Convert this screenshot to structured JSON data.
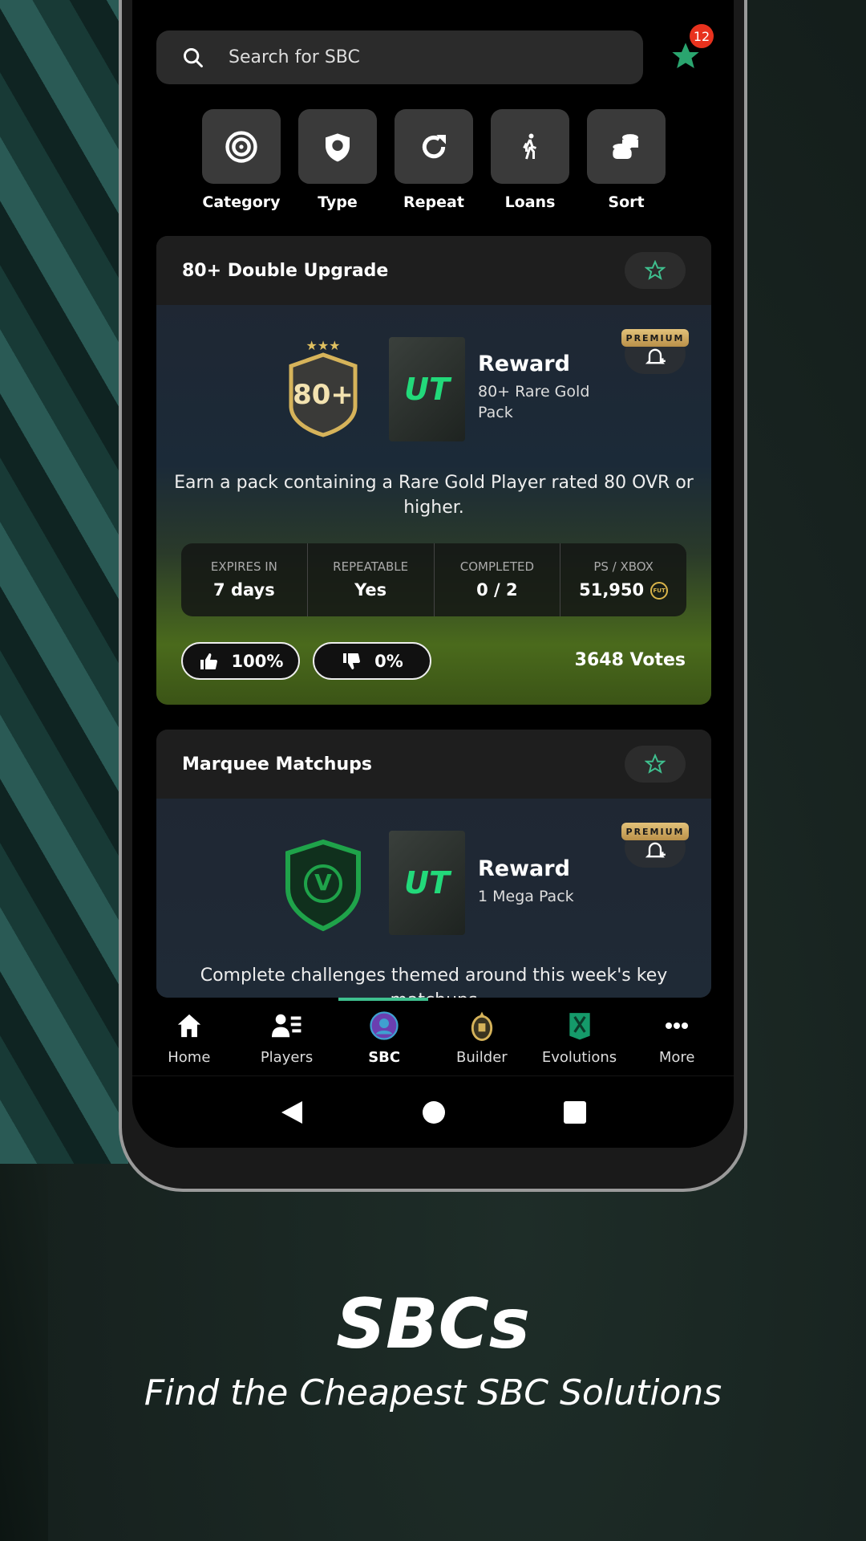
{
  "search": {
    "placeholder": "Search for SBC"
  },
  "favorites": {
    "count": "12"
  },
  "filters": [
    {
      "label": "Category",
      "icon": "target-icon"
    },
    {
      "label": "Type",
      "icon": "shield-ball-icon"
    },
    {
      "label": "Repeat",
      "icon": "repeat-icon"
    },
    {
      "label": "Loans",
      "icon": "walking-icon"
    },
    {
      "label": "Sort",
      "icon": "coins-icon"
    }
  ],
  "cards": [
    {
      "title": "80+ Double Upgrade",
      "premium": "PREMIUM",
      "reward_title": "Reward",
      "reward": "80+ Rare Gold Pack",
      "badge_text": "80+",
      "pack_text": "UT",
      "description": "Earn a pack containing a Rare Gold Player rated 80 OVR or higher.",
      "stats": [
        {
          "label": "EXPIRES IN",
          "value": "7 days"
        },
        {
          "label": "REPEATABLE",
          "value": "Yes"
        },
        {
          "label": "COMPLETED",
          "value": "0 / 2"
        },
        {
          "label": "PS / XBOX",
          "value": "51,950"
        }
      ],
      "coin_label": "FUT",
      "upvote": "100%",
      "downvote": "0%",
      "votes": "3648 Votes"
    },
    {
      "title": "Marquee Matchups",
      "premium": "PREMIUM",
      "reward_title": "Reward",
      "reward": "1 Mega Pack",
      "badge_text": "V",
      "pack_text": "UT",
      "description": "Complete challenges themed around this week's key matchups"
    }
  ],
  "nav": [
    {
      "label": "Home"
    },
    {
      "label": "Players"
    },
    {
      "label": "SBC",
      "active": true
    },
    {
      "label": "Builder"
    },
    {
      "label": "Evolutions"
    },
    {
      "label": "More"
    }
  ],
  "colors": {
    "accent": "#3fc08f",
    "badge": "#e8321e",
    "premium": "#d9b46a"
  },
  "promo": {
    "title": "SBCs",
    "subtitle": "Find the Cheapest SBC Solutions"
  }
}
